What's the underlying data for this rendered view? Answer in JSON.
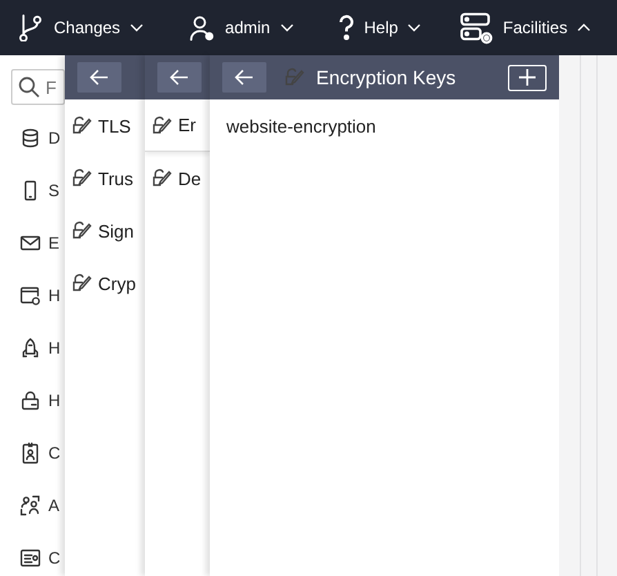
{
  "top_bar": {
    "menus": [
      {
        "label": "Changes",
        "expanded": false
      },
      {
        "label": "admin",
        "expanded": false
      },
      {
        "label": "Help",
        "expanded": false
      },
      {
        "label": "Facilities",
        "expanded": true
      }
    ]
  },
  "sidebar": {
    "search": {
      "placeholder": "F"
    },
    "items": [
      {
        "label": "D"
      },
      {
        "label": "S"
      },
      {
        "label": "E"
      },
      {
        "label": "H"
      },
      {
        "label": "H"
      },
      {
        "label": "H"
      },
      {
        "label": "C"
      },
      {
        "label": "A"
      },
      {
        "label": "C"
      }
    ]
  },
  "panels": [
    {
      "items": [
        {
          "label": "TLS",
          "selected": false
        },
        {
          "label": "Trus",
          "selected": false
        },
        {
          "label": "Sign",
          "selected": false
        },
        {
          "label": "Cryp",
          "selected": false
        }
      ]
    },
    {
      "items": [
        {
          "label": "Er",
          "selected": true
        },
        {
          "label": "De",
          "selected": false
        }
      ]
    },
    {
      "title": "Encryption Keys",
      "items": [
        {
          "label": "website-encryption",
          "selected": false
        }
      ]
    }
  ]
}
